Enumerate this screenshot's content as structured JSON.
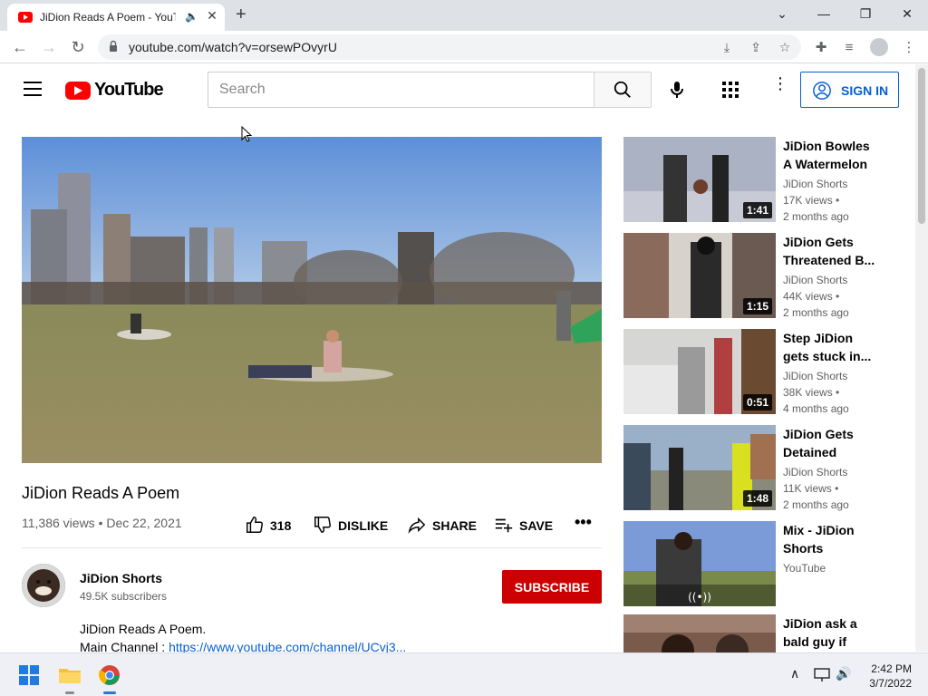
{
  "browser": {
    "tab_title": "JiDion Reads A Poem - YouTube",
    "tab_audio_icon": "speaker-icon",
    "url": "youtube.com/watch?v=orsewPOvyrU",
    "new_tab": "+"
  },
  "youtube": {
    "logo_text": "YouTube",
    "search_placeholder": "Search",
    "sign_in_label": "SIGN IN",
    "brand_color": "#ff0000",
    "accent_color": "#065fd4"
  },
  "video": {
    "title": "JiDion Reads A Poem",
    "views_date": "11,386 views • Dec 22, 2021",
    "like_count": "318",
    "dislike_label": "DISLIKE",
    "share_label": "SHARE",
    "save_label": "SAVE",
    "channel_name": "JiDion Shorts",
    "subscribers": "49.5K subscribers",
    "subscribe_label": "SUBSCRIBE",
    "description_line1": "JiDion Reads A Poem.",
    "description_line2_prefix": "Main Channel : ",
    "description_link": "https://www.youtube.com/channel/UCvj3..."
  },
  "recommendations": [
    {
      "title": "JiDion Bowles A Watermelon",
      "channel": "JiDion Shorts",
      "views": "17K views •",
      "age": "2 months ago",
      "duration": "1:41"
    },
    {
      "title": "JiDion Gets Threatened B...",
      "channel": "JiDion Shorts",
      "views": "44K views •",
      "age": "2 months ago",
      "duration": "1:15"
    },
    {
      "title": "Step JiDion gets stuck in...",
      "channel": "JiDion Shorts",
      "views": "38K views •",
      "age": "4 months ago",
      "duration": "0:51"
    },
    {
      "title": "JiDion Gets Detained",
      "channel": "JiDion Shorts",
      "views": "11K views •",
      "age": "2 months ago",
      "duration": "1:48"
    },
    {
      "title": "Mix - JiDion Shorts",
      "channel": "YouTube",
      "views": "",
      "age": "",
      "duration": ""
    },
    {
      "title": "JiDion ask a bald guy if his...",
      "channel": "",
      "views": "",
      "age": "",
      "duration": ""
    }
  ],
  "taskbar": {
    "time": "2:42 PM",
    "date": "3/7/2022"
  }
}
